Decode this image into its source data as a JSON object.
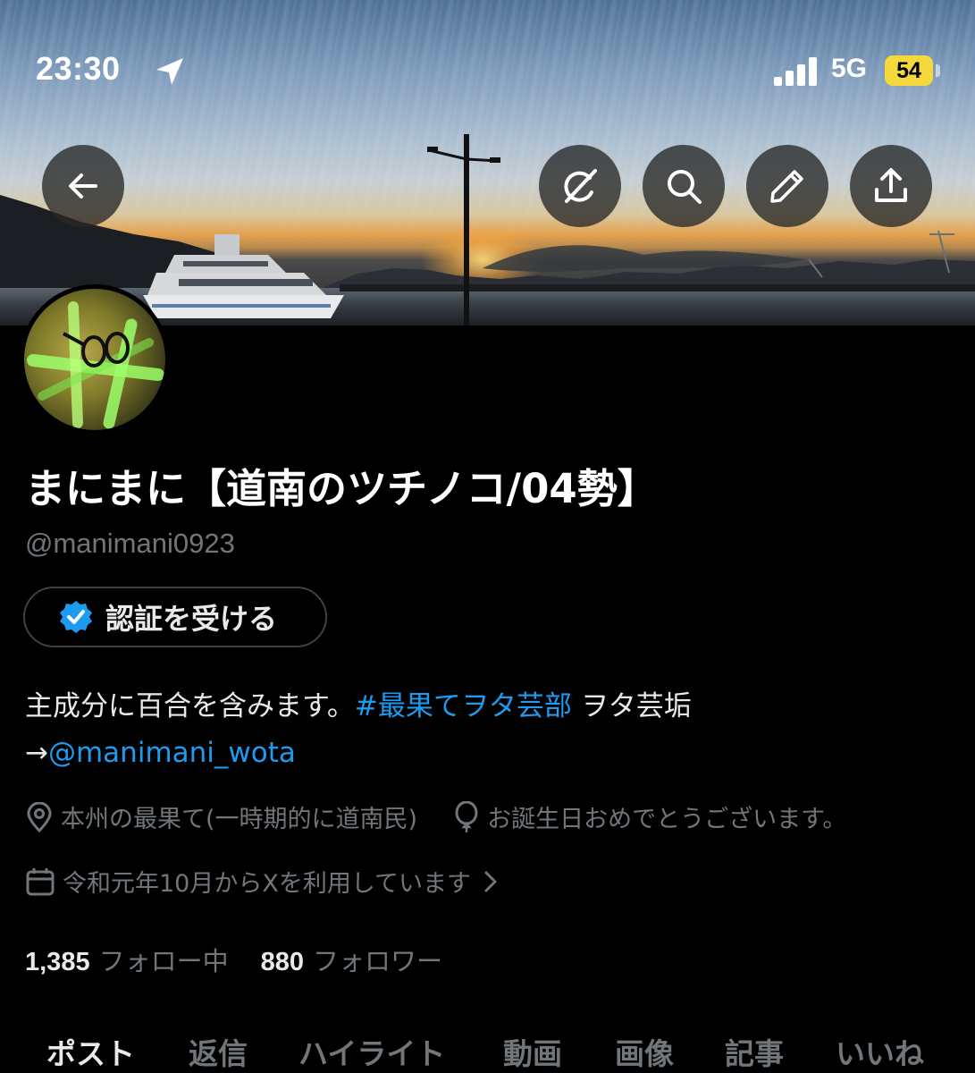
{
  "status_bar": {
    "time": "23:30",
    "network": "5G",
    "battery": "54"
  },
  "header": {
    "buttons": [
      "back",
      "grok",
      "search",
      "edit",
      "share"
    ]
  },
  "profile": {
    "display_name": "まにまに【道南のツチノコ/04勢】",
    "handle": "@manimani0923",
    "verify_button_label": "認証を受ける",
    "bio": {
      "text_1": "主成分に百合を含みます。",
      "hashtag": "#最果てヲタ芸部",
      "text_2": " ヲタ芸垢",
      "arrow": "→",
      "mention": "@manimani_wota"
    },
    "location": "本州の最果て(一時期的に道南民)",
    "birthday": "お誕生日おめでとうございます。",
    "joined": "令和元年10月からXを利用しています"
  },
  "stats": {
    "following_count": "1,385",
    "following_label": "フォロー中",
    "followers_count": "880",
    "followers_label": "フォロワー"
  },
  "tabs": [
    "ポスト",
    "返信",
    "ハイライト",
    "動画",
    "画像",
    "記事",
    "いいね"
  ],
  "colors": {
    "background": "#000000",
    "accent": "#1d9bf0",
    "secondary_text": "#71767b",
    "battery": "#f5d93c"
  }
}
